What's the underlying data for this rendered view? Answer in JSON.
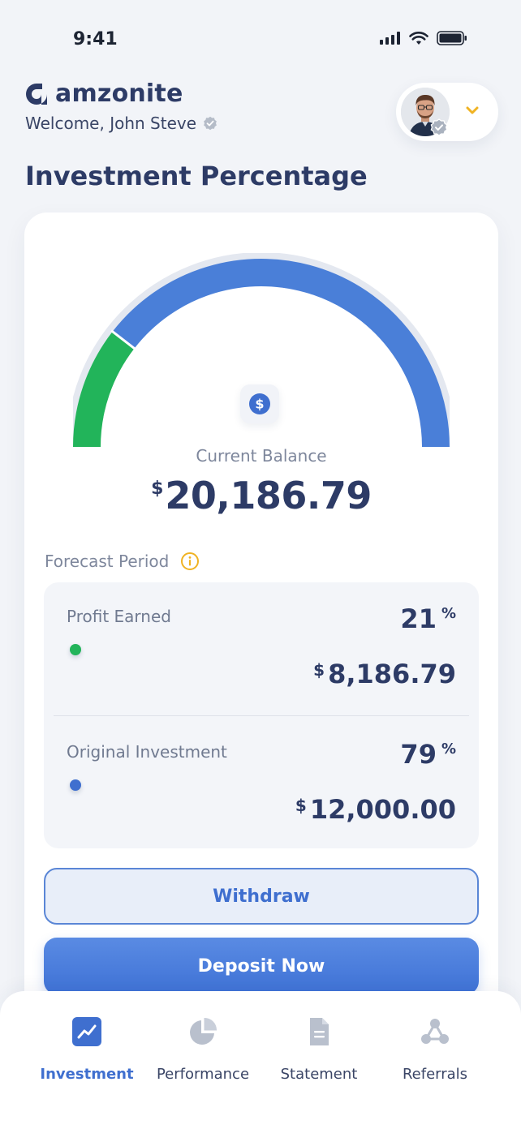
{
  "status_bar": {
    "time": "9:41"
  },
  "header": {
    "brand_name": "amzonite",
    "welcome": "Welcome, John Steve"
  },
  "page_title": "Investment Percentage",
  "balance": {
    "label": "Current Balance",
    "currency": "$",
    "value": "20,186.79"
  },
  "gauge": {
    "profit_fraction": 0.21,
    "investment_fraction": 0.79
  },
  "forecast": {
    "label": "Forecast Period"
  },
  "stats": {
    "profit": {
      "label": "Profit Earned",
      "percent": "21",
      "percent_sign": "%",
      "currency": "$",
      "amount": "8,186.79"
    },
    "investment": {
      "label": "Original Investment",
      "percent": "79",
      "percent_sign": "%",
      "currency": "$",
      "amount": "12,000.00"
    }
  },
  "buttons": {
    "withdraw": "Withdraw",
    "deposit": "Deposit Now"
  },
  "nav": {
    "items": [
      {
        "label": "Investment",
        "icon": "trend-chart-icon",
        "active": true
      },
      {
        "label": "Performance",
        "icon": "pie-chart-icon",
        "active": false
      },
      {
        "label": "Statement",
        "icon": "document-icon",
        "active": false
      },
      {
        "label": "Referrals",
        "icon": "network-icon",
        "active": false
      }
    ]
  },
  "colors": {
    "primary": "#3f6fcf",
    "gauge_blue": "#4a7fd8",
    "gauge_green": "#22b45a",
    "accent_yellow": "#f0b323",
    "text_dark": "#2d3b66"
  }
}
